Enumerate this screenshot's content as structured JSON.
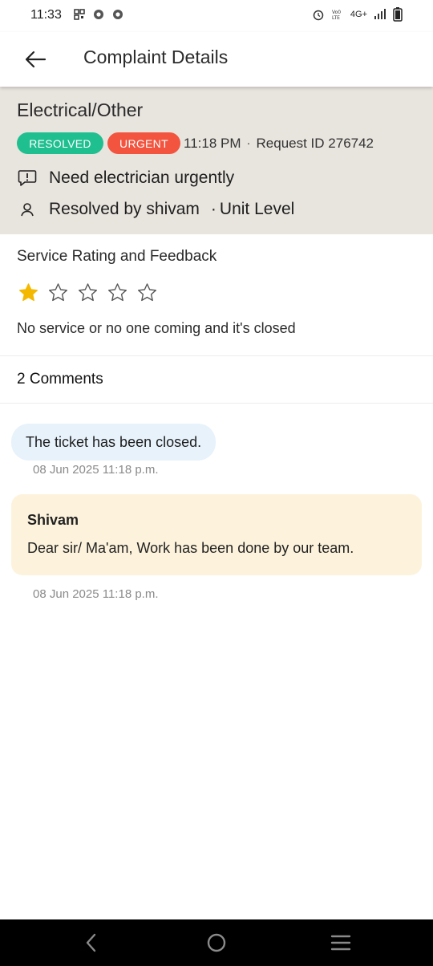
{
  "status_bar": {
    "time": "11:33",
    "network": "4G+",
    "left_icons": [
      "qr-icon",
      "chrome-icon",
      "chrome-icon"
    ],
    "right_icons": [
      "alarm-icon",
      "volte-icon",
      "signal-icon",
      "battery-icon"
    ]
  },
  "app_bar": {
    "title": "Complaint Details",
    "back_icon": "arrow-left-icon"
  },
  "complaint": {
    "category": "Electrical/Other",
    "status_badge": "RESOLVED",
    "priority_badge": "URGENT",
    "time": "11:18 PM",
    "separator": "·",
    "request_id": "Request ID 276742",
    "description": "Need electrician urgently",
    "resolved_by": "Resolved by shivam",
    "level": "Unit Level",
    "colors": {
      "resolved": "#1fbf8f",
      "urgent": "#f2543f",
      "header_bg": "#e8e4de"
    }
  },
  "rating": {
    "title": "Service Rating and Feedback",
    "value": 1,
    "max": 5,
    "feedback": "No service or no one coming and it's closed",
    "star_color": "#f5b800"
  },
  "comments": {
    "count_label": "2 Comments",
    "items": [
      {
        "author": "",
        "text": "The ticket has been closed.",
        "timestamp": "08 Jun 2025 11:18 p.m."
      },
      {
        "author": "Shivam",
        "text": "Dear sir/ Ma'am, Work has been done by our team.",
        "timestamp": "08 Jun 2025 11:18 p.m."
      }
    ]
  },
  "nav_bar": {
    "icons": [
      "nav-back-icon",
      "nav-home-icon",
      "nav-recents-icon"
    ]
  }
}
